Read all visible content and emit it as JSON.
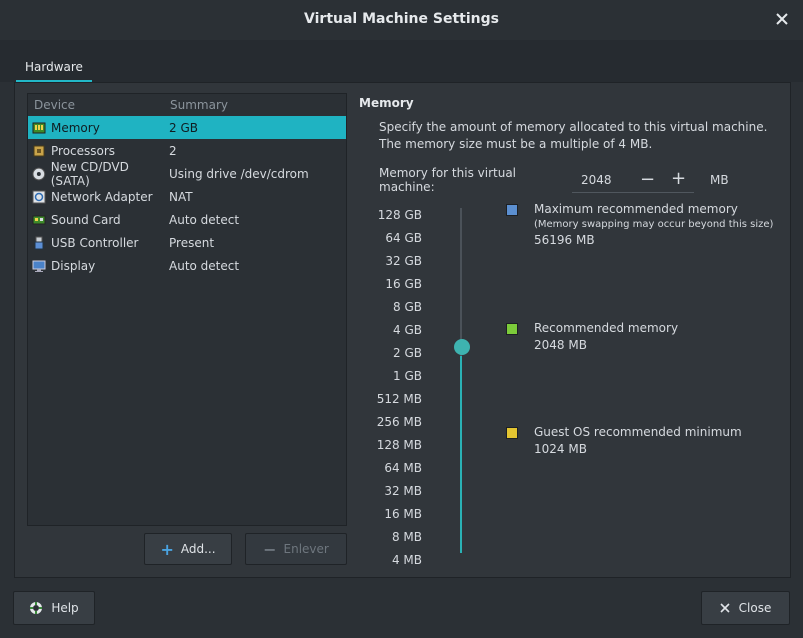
{
  "window": {
    "title": "Virtual Machine Settings"
  },
  "tabs": [
    {
      "label": "Hardware"
    }
  ],
  "device_list": {
    "headers": {
      "device": "Device",
      "summary": "Summary"
    },
    "items": [
      {
        "device": "Memory",
        "summary": "2 GB",
        "icon": "memory-icon"
      },
      {
        "device": "Processors",
        "summary": "2",
        "icon": "processor-icon"
      },
      {
        "device": "New CD/DVD (SATA)",
        "summary": "Using drive /dev/cdrom",
        "icon": "cd-dvd-icon"
      },
      {
        "device": "Network Adapter",
        "summary": "NAT",
        "icon": "network-adapter-icon"
      },
      {
        "device": "Sound Card",
        "summary": "Auto detect",
        "icon": "sound-card-icon"
      },
      {
        "device": "USB Controller",
        "summary": "Present",
        "icon": "usb-icon"
      },
      {
        "device": "Display",
        "summary": "Auto detect",
        "icon": "display-icon"
      }
    ],
    "add_label": "Add...",
    "remove_label": "Enlever"
  },
  "memory": {
    "section_title": "Memory",
    "description": "Specify the amount of memory allocated to this virtual machine. The memory size must be a multiple of 4 MB.",
    "field_label": "Memory for this virtual machine:",
    "value": "2048",
    "unit": "MB",
    "scale": [
      "128 GB",
      "64 GB",
      "32 GB",
      "16 GB",
      "8 GB",
      "4 GB",
      "2 GB",
      "1 GB",
      "512 MB",
      "256 MB",
      "128 MB",
      "64 MB",
      "32 MB",
      "16 MB",
      "8 MB",
      "4 MB"
    ],
    "slider_selected_index": 6,
    "legend": {
      "max": {
        "title": "Maximum recommended memory",
        "note": "(Memory swapping may occur beyond this size)",
        "value": "56196 MB",
        "color": "#5b8fd0"
      },
      "recommended": {
        "title": "Recommended memory",
        "value": "2048 MB",
        "color": "#7ccb3a"
      },
      "minimum": {
        "title": "Guest OS recommended minimum",
        "value": "1024 MB",
        "color": "#e3c531"
      }
    }
  },
  "footer": {
    "help_label": "Help",
    "close_label": "Close"
  },
  "colors": {
    "accent": "#1fb3c2",
    "slider": "#3eb3b0"
  }
}
